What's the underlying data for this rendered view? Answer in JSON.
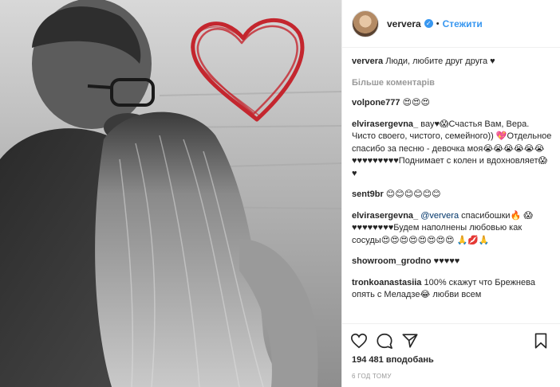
{
  "post": {
    "username": "ververa",
    "verified_badge": "✓",
    "separator": "•",
    "follow_label": "Стежити",
    "caption_user": "ververa",
    "caption_text": "Люди, любите друг друга ♥",
    "more_comments_label": "Більше коментарів",
    "likes_text": "194 481 вподобань",
    "timestamp": "6 ГОД ТОМУ"
  },
  "comments": [
    {
      "user": "volpone777",
      "text": " 😍😍😍"
    },
    {
      "user": "elvirasergevna_",
      "text": " вау♥😱Счастья Вам, Вера. Чисто своего, чистого, семейного)) 💖Отдельное спасибо за песню - девочка моя😭😭😭😭😭😭♥♥♥♥♥♥♥♥♥Поднимает с колен и вдохновляет😱 ♥"
    },
    {
      "user": "sent9br",
      "text": " 😊😊😊😊😊😊"
    },
    {
      "user": "elvirasergevna_",
      "mention": "@ververa",
      "text": " спасибошки🔥 😱♥♥♥♥♥♥♥♥Будем наполнены любовью как сосуды😍😍😍😍😍😍😍😍 🙏💋🙏"
    },
    {
      "user": "showroom_grodno",
      "text": " ♥♥♥♥♥"
    },
    {
      "user": "tronkoanastasiia",
      "text": " 100% скажут что Брежнева опять с Меладзе😂 любви всем"
    }
  ],
  "icons": {
    "like": "heart-outline-icon",
    "comment": "speech-bubble-icon",
    "share": "paper-plane-icon",
    "save": "bookmark-icon"
  },
  "colors": {
    "link": "#3897f0",
    "heart_drawing": "#c4262e",
    "muted": "#999999"
  }
}
